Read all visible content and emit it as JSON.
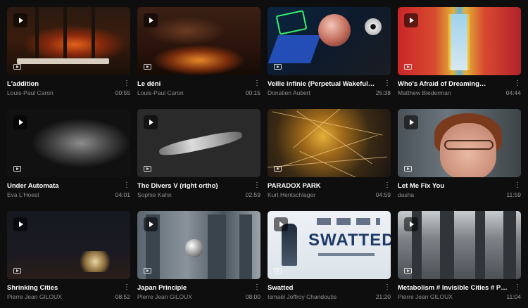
{
  "videos": [
    {
      "title": "L'addition",
      "author": "Louis-Paul Caron",
      "duration": "00:55"
    },
    {
      "title": "Le déni",
      "author": "Louis-Paul Caron",
      "duration": "00:15"
    },
    {
      "title": "Veille infinie (Perpetual Wakeful…",
      "author": "Donatien Aubert",
      "duration": "25:38"
    },
    {
      "title": "Who's Afraid of Dreaming…",
      "author": "Matthew Biederman",
      "duration": "04:44"
    },
    {
      "title": "Under Automata",
      "author": "Eva L'Hoest",
      "duration": "04:01"
    },
    {
      "title": "The Divers V (right ortho)",
      "author": "Sophie Kahn",
      "duration": "02:59"
    },
    {
      "title": "PARADOX PARK",
      "author": "Kurt Hentschlager",
      "duration": "04:59"
    },
    {
      "title": "Let Me Fix You",
      "author": "dasha",
      "duration": "11:59"
    },
    {
      "title": "Shrinking Cities",
      "author": "Pierre Jean GILOUX",
      "duration": "08:52"
    },
    {
      "title": "Japan Principle",
      "author": "Pierre Jean GILOUX",
      "duration": "08:00"
    },
    {
      "title": "Swatted",
      "author": "Ismaël Joffroy Chandoutis",
      "duration": "21:20"
    },
    {
      "title": "Metabolism # Invisible Cities # P…",
      "author": "Pierre Jean GILOUX",
      "duration": "11:04"
    }
  ],
  "thumbnail_text": {
    "swatted_poster": "SWATTED"
  },
  "icons": {
    "play": "play-icon",
    "video_badge": "video-badge-icon",
    "more": "more-vertical-icon"
  },
  "more_glyph": "⋮"
}
